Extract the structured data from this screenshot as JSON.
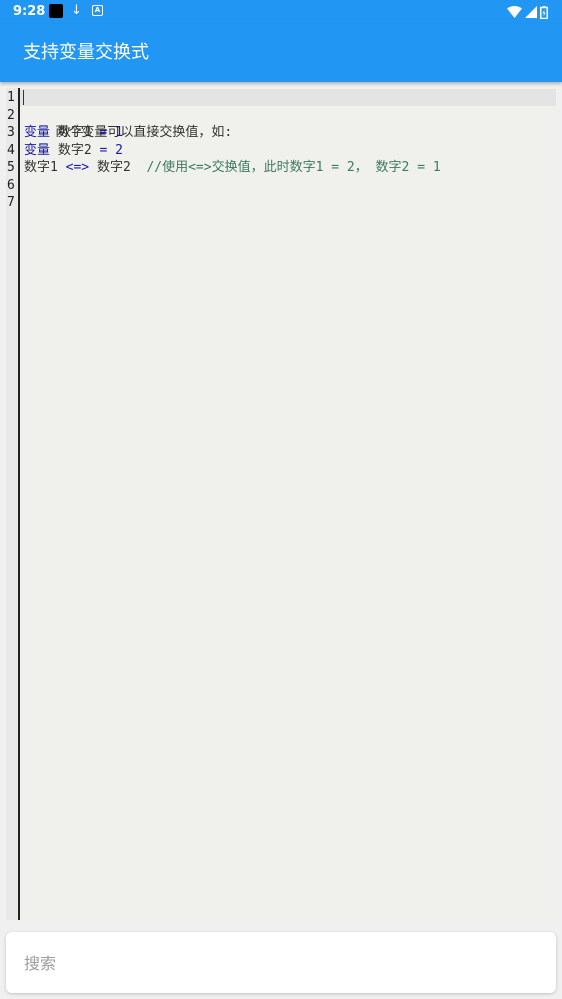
{
  "status_bar": {
    "time": "9:28",
    "download_icon": "↓",
    "a_icon": "A"
  },
  "app_bar": {
    "title": "支持变量交换式"
  },
  "editor": {
    "line_numbers": [
      "1",
      "2",
      "3",
      "4",
      "5",
      "6",
      "7"
    ],
    "lines": {
      "l2": "两个变量可以直接交换值，如:",
      "l3": {
        "kw": "变量",
        "name": " 数字1 ",
        "op": "=",
        "num": " 1"
      },
      "l4": {
        "kw": "变量",
        "name": " 数字2 ",
        "op": "=",
        "num": " 2"
      },
      "l5": {
        "left": "数字1 ",
        "op": "<=>",
        "right": " 数字2  ",
        "comment": "//使用<=>交换值，此时数字1 = 2， 数字2 = 1"
      }
    }
  },
  "search": {
    "placeholder": "搜索",
    "value": ""
  },
  "colors": {
    "primary": "#2196f3",
    "keyword": "#1a1aa6",
    "comment": "#3d7a62",
    "editor_bg": "#f0f0ec"
  }
}
